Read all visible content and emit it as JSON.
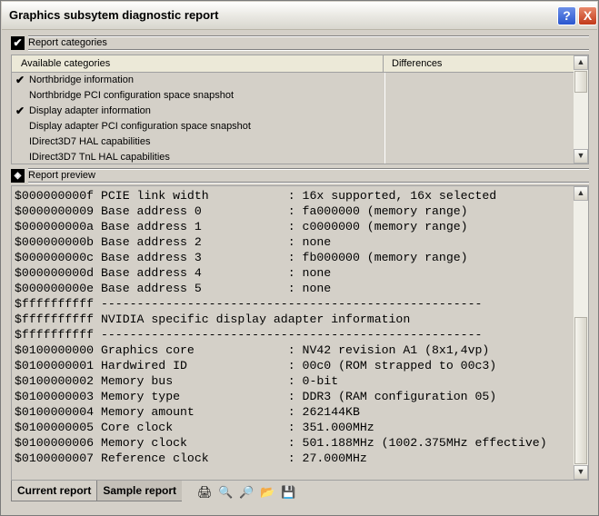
{
  "window": {
    "title": "Graphics subsytem diagnostic report"
  },
  "titlebar_buttons": {
    "help": "?",
    "close": "X"
  },
  "categories_section": {
    "label": "Report categories",
    "checked": true,
    "columns": [
      "Available categories",
      "Differences"
    ],
    "rows": [
      {
        "name": "Northbridge information",
        "checked": true
      },
      {
        "name": "Northbridge PCI configuration space snapshot",
        "checked": false
      },
      {
        "name": "Display adapter information",
        "checked": true
      },
      {
        "name": "Display adapter PCI configuration space snapshot",
        "checked": false
      },
      {
        "name": "IDirect3D7 HAL capabilities",
        "checked": false
      },
      {
        "name": "IDirect3D7 TnL HAL capabilities",
        "checked": false
      }
    ]
  },
  "preview_section": {
    "label": "Report preview",
    "lines": [
      "$000000000f PCIE link width           : 16x supported, 16x selected",
      "$0000000009 Base address 0            : fa000000 (memory range)",
      "$000000000a Base address 1            : c0000000 (memory range)",
      "$000000000b Base address 2            : none",
      "$000000000c Base address 3            : fb000000 (memory range)",
      "$000000000d Base address 4            : none",
      "$000000000e Base address 5            : none",
      "$ffffffffff -----------------------------------------------------",
      "$ffffffffff NVIDIA specific display adapter information",
      "$ffffffffff -----------------------------------------------------",
      "$0100000000 Graphics core             : NV42 revision A1 (8x1,4vp)",
      "$0100000001 Hardwired ID              : 00c0 (ROM strapped to 00c3)",
      "$0100000002 Memory bus                : 0-bit",
      "$0100000003 Memory type               : DDR3 (RAM configuration 05)",
      "$0100000004 Memory amount             : 262144KB",
      "$0100000005 Core clock                : 351.000MHz",
      "$0100000006 Memory clock              : 501.188MHz (1002.375MHz effective)",
      "$0100000007 Reference clock           : 27.000MHz"
    ]
  },
  "tabs": [
    {
      "label": "Current report",
      "active": true
    },
    {
      "label": "Sample report",
      "active": false
    }
  ],
  "toolbar": [
    {
      "icon": "print-icon",
      "glyph": "🖨"
    },
    {
      "icon": "preview-icon",
      "glyph": "🔍"
    },
    {
      "icon": "preview-sample-icon",
      "glyph": "🔎"
    },
    {
      "icon": "open-folder-icon",
      "glyph": "📂"
    },
    {
      "icon": "save-icon",
      "glyph": "💾"
    }
  ]
}
